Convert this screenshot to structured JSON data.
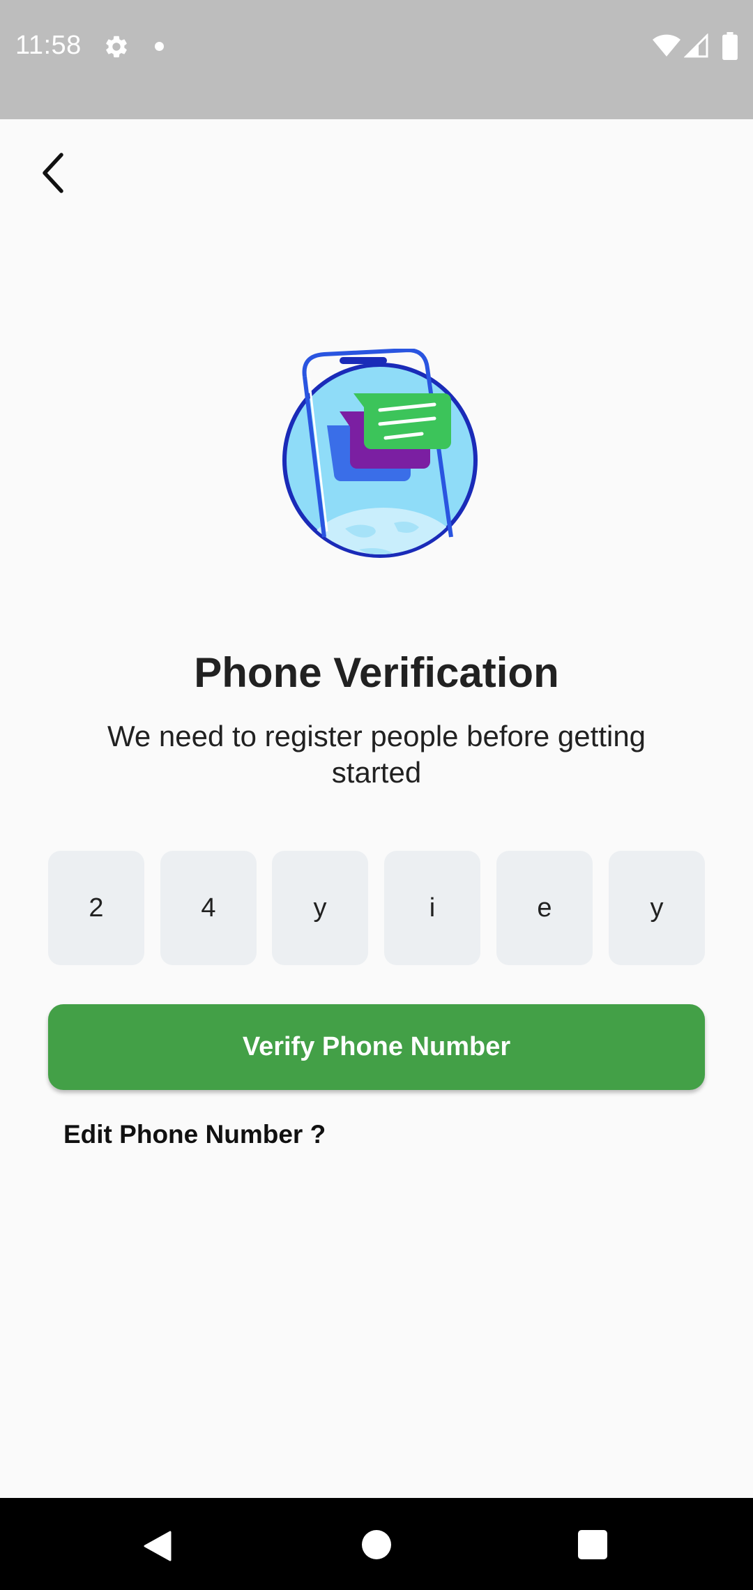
{
  "status_bar": {
    "time": "11:58",
    "icons": [
      "gear-icon",
      "notification-dot-icon",
      "wifi-icon",
      "signal-icon",
      "battery-icon"
    ]
  },
  "header": {
    "back_icon": "chevron-left-icon"
  },
  "illustration": {
    "icon": "phone-chat-globe-illustration",
    "colors": {
      "circle": "#8fdcf8",
      "ring": "#1a2bb8",
      "phone_frame": "#2a55e0",
      "bubble_blue": "#3a6ee8",
      "bubble_purple": "#7b1fa2",
      "bubble_green": "#3cc45a"
    }
  },
  "main": {
    "title": "Phone Verification",
    "subtitle": "We need to register people before getting started",
    "otp_digits": [
      "2",
      "4",
      "y",
      "i",
      "e",
      "y"
    ],
    "verify_button_label": "Verify Phone Number",
    "edit_phone_label": "Edit Phone Number ?"
  },
  "colors": {
    "accent_green": "#43a047",
    "otp_box_bg": "#eceff2",
    "background": "#fafafa",
    "status_bar_bg": "#bdbdbd"
  },
  "nav_bar": {
    "icons": [
      "back-triangle-icon",
      "home-circle-icon",
      "recents-square-icon"
    ]
  }
}
